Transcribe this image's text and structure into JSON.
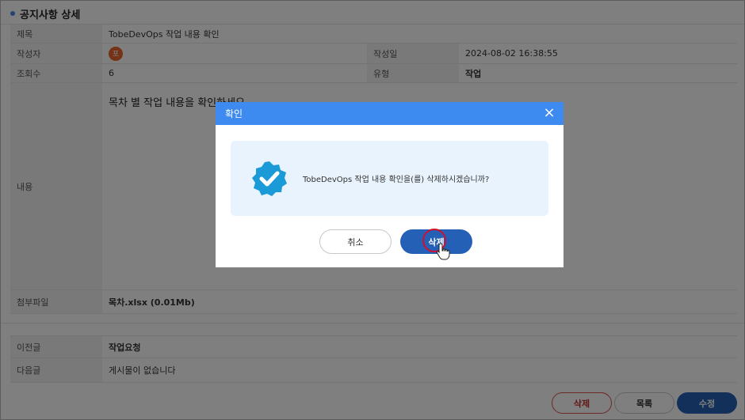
{
  "page": {
    "title": "공지사항 상세"
  },
  "detail": {
    "title_label": "제목",
    "title_value": "TobeDevOps 작업 내용 확인",
    "author_label": "작성자",
    "author_initial": "포",
    "date_label": "작성일",
    "date_value": "2024-08-02 16:38:55",
    "views_label": "조회수",
    "views_value": "6",
    "type_label": "유형",
    "type_value": "작업",
    "content_label": "내용",
    "content_text": "목차 별 작업 내용을 확인하세요",
    "attachment_label": "첨부파일",
    "attachment_value": "목차.xlsx (0.01Mb)"
  },
  "navigation": {
    "prev_label": "이전글",
    "prev_value": "작업요청",
    "next_label": "다음글",
    "next_value": "게시물이 없습니다"
  },
  "actions": {
    "delete_label": "삭제",
    "list_label": "목록",
    "edit_label": "수정"
  },
  "modal": {
    "title": "확인",
    "message": "TobeDevOps 작업 내용 확인을(를) 삭제하시겠습니까?",
    "cancel_label": "취소",
    "confirm_label": "삭제",
    "icon": "verified-check-icon"
  },
  "colors": {
    "accent": "#3d8bf0",
    "primary_button": "#2460b5",
    "danger_outline": "#d9534f",
    "avatar": "#e8652e"
  }
}
